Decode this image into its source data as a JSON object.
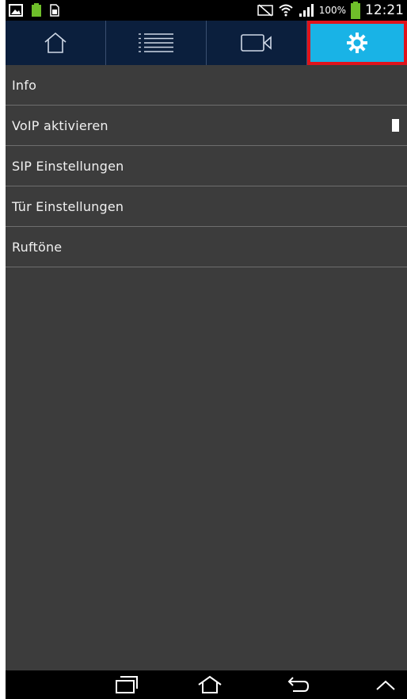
{
  "status_bar": {
    "battery_percent": "100%",
    "time": "12:21",
    "icons": [
      "image-notification-icon",
      "battery-small-icon",
      "sim-card-icon",
      "mute-icon",
      "wifi-icon",
      "signal-icon",
      "battery-icon"
    ]
  },
  "tabs": [
    {
      "name": "home",
      "icon": "home-icon",
      "active": false
    },
    {
      "name": "list",
      "icon": "list-icon",
      "active": false
    },
    {
      "name": "video",
      "icon": "video-camera-icon",
      "active": false
    },
    {
      "name": "settings",
      "icon": "gear-icon",
      "active": true
    }
  ],
  "menu": {
    "items": [
      {
        "label": "Info"
      },
      {
        "label": "VoIP aktivieren",
        "toggle_on": false
      },
      {
        "label": "SIP Einstellungen"
      },
      {
        "label": "Tür Einstellungen"
      },
      {
        "label": "Ruftöne"
      }
    ]
  },
  "colors": {
    "active_tab": "#19b3e6",
    "active_tab_highlight": "#e0131b",
    "tabbar_bg": "#0b1f3d",
    "content_bg": "#3c3c3c"
  },
  "nav_bar": {
    "icons": [
      "recent-apps-icon",
      "home-icon",
      "back-icon",
      "up-arrow-icon"
    ]
  }
}
